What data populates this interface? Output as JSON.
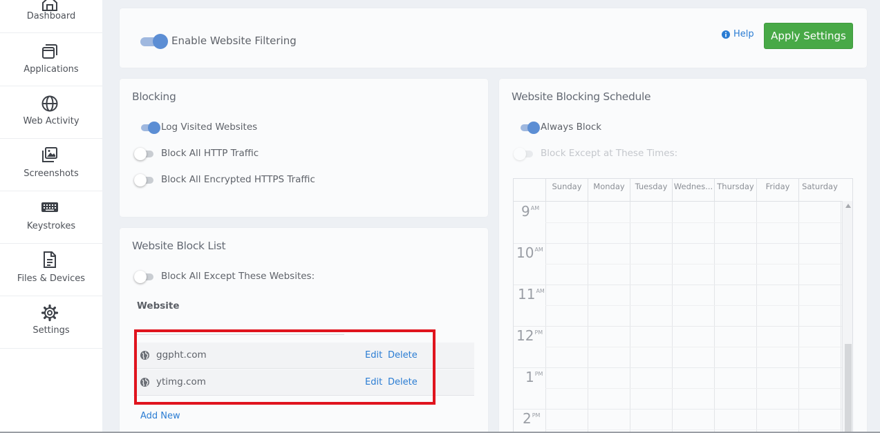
{
  "sidebar": {
    "items": [
      {
        "label": "Dashboard",
        "icon": "home-icon"
      },
      {
        "label": "Applications",
        "icon": "windows-icon"
      },
      {
        "label": "Web Activity",
        "icon": "globe-icon"
      },
      {
        "label": "Screenshots",
        "icon": "images-icon"
      },
      {
        "label": "Keystrokes",
        "icon": "keyboard-icon"
      },
      {
        "label": "Files & Devices",
        "icon": "file-icon"
      },
      {
        "label": "Settings",
        "icon": "gear-icon"
      }
    ]
  },
  "top": {
    "enable_label": "Enable Website Filtering",
    "enable_on": true,
    "help_label": "Help",
    "apply_label": "Apply Settings"
  },
  "blocking": {
    "title": "Blocking",
    "options": [
      {
        "label": "Log Visited Websites",
        "on": true
      },
      {
        "label": "Block All HTTP Traffic",
        "on": false
      },
      {
        "label": "Block All Encrypted HTTPS Traffic",
        "on": false
      }
    ]
  },
  "blocklist": {
    "title": "Website Block List",
    "except_label": "Block All Except These Websites:",
    "except_on": false,
    "column_header": "Website",
    "rows": [
      {
        "site": "ggpht.com",
        "edit": "Edit",
        "delete": "Delete"
      },
      {
        "site": "ytimg.com",
        "edit": "Edit",
        "delete": "Delete"
      }
    ],
    "add_new": "Add New"
  },
  "schedule": {
    "title": "Website Blocking Schedule",
    "always_label": "Always Block",
    "always_on": true,
    "except_label": "Block Except at These Times:",
    "except_on": false,
    "days": [
      "Sunday",
      "Monday",
      "Tuesday",
      "Wednes...",
      "Thursday",
      "Friday",
      "Saturday"
    ],
    "hours": [
      {
        "n": "9",
        "ap": "AM"
      },
      {
        "n": "10",
        "ap": "AM"
      },
      {
        "n": "11",
        "ap": "AM"
      },
      {
        "n": "12",
        "ap": "PM"
      },
      {
        "n": "1",
        "ap": "PM"
      },
      {
        "n": "2",
        "ap": "PM"
      }
    ]
  },
  "colors": {
    "accent": "#2a7cd3",
    "apply_green": "#48a947",
    "toggle_on": "#5c8ed4",
    "highlight": "#e0141e"
  }
}
